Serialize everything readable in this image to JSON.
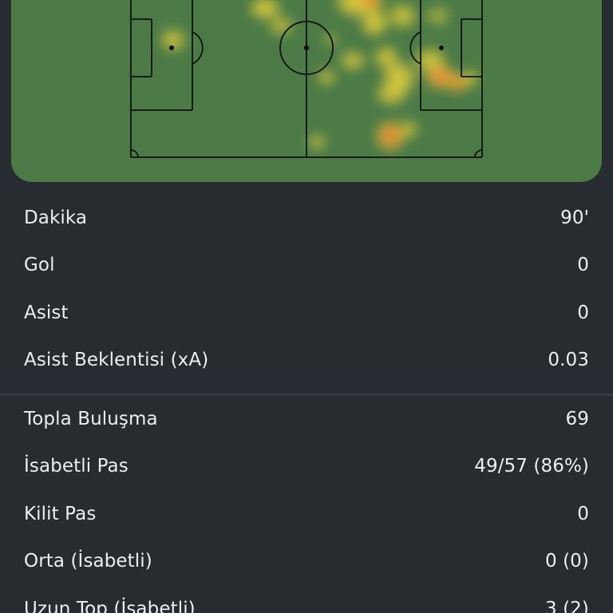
{
  "heatmap": {
    "pitch_color": "#4b7a47",
    "line_color": "#111111",
    "heat_colors": [
      "#f2d13a",
      "#f4a531",
      "#ef7a2c"
    ]
  },
  "stats_group_1": [
    {
      "label": "Dakika",
      "value": "90'"
    },
    {
      "label": "Gol",
      "value": "0"
    },
    {
      "label": "Asist",
      "value": "0"
    },
    {
      "label": "Asist Beklentisi (xA)",
      "value": "0.03"
    }
  ],
  "stats_group_2": [
    {
      "label": "Topla Buluşma",
      "value": "69"
    },
    {
      "label": "İsabetli Pas",
      "value": "49/57 (86%)"
    },
    {
      "label": "Kilit Pas",
      "value": "0"
    },
    {
      "label": "Orta (İsabetli)",
      "value": "0 (0)"
    },
    {
      "label": "Uzun Top (İsabetli)",
      "value": "3 (2)"
    }
  ]
}
